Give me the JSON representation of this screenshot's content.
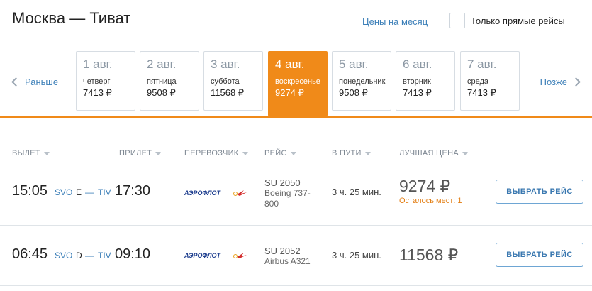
{
  "header": {
    "route_title": "Москва — Тиват",
    "month_prices_link": "Цены на месяц",
    "direct_only_label": "Только прямые рейсы",
    "direct_only_checked": false
  },
  "date_nav": {
    "prev_label": "Раньше",
    "next_label": "Позже",
    "dates": [
      {
        "date": "1 авг.",
        "weekday": "четверг",
        "price": "7413 ₽",
        "active": false
      },
      {
        "date": "2 авг.",
        "weekday": "пятница",
        "price": "9508 ₽",
        "active": false
      },
      {
        "date": "3 авг.",
        "weekday": "суббота",
        "price": "11568 ₽",
        "active": false
      },
      {
        "date": "4 авг.",
        "weekday": "воскресенье",
        "price": "9274 ₽",
        "active": true
      },
      {
        "date": "5 авг.",
        "weekday": "понедельник",
        "price": "9508 ₽",
        "active": false
      },
      {
        "date": "6 авг.",
        "weekday": "вторник",
        "price": "7413 ₽",
        "active": false
      },
      {
        "date": "7 авг.",
        "weekday": "среда",
        "price": "7413 ₽",
        "active": false
      }
    ]
  },
  "columns": {
    "departure": "ВЫЛЕТ",
    "arrival": "ПРИЛЕТ",
    "carrier": "ПЕРЕВОЗЧИК",
    "flight": "РЕЙС",
    "duration": "В ПУТИ",
    "best_price": "ЛУЧШАЯ ЦЕНА"
  },
  "flights": [
    {
      "dep_time": "15:05",
      "dep_airport": "SVO",
      "dep_terminal": "E",
      "dash": "—",
      "arr_airport": "TIV",
      "arr_time": "17:30",
      "carrier_logo": "aeroflot-logo",
      "flight_no": "SU 2050",
      "aircraft": "Boeing 737-800",
      "duration": "3 ч. 25 мин.",
      "price": "9274 ₽",
      "seats_left": "Осталось мест: 1",
      "button": "ВЫБРАТЬ РЕЙС"
    },
    {
      "dep_time": "06:45",
      "dep_airport": "SVO",
      "dep_terminal": "D",
      "dash": "—",
      "arr_airport": "TIV",
      "arr_time": "09:10",
      "carrier_logo": "aeroflot-logo",
      "flight_no": "SU 2052",
      "aircraft": "Airbus A321",
      "duration": "3 ч. 25 мин.",
      "price": "11568 ₽",
      "seats_left": "",
      "button": "ВЫБРАТЬ РЕЙС"
    }
  ],
  "colors": {
    "accent": "#f08a19",
    "link": "#3c7fb8",
    "seats_warning": "#e27c10"
  }
}
